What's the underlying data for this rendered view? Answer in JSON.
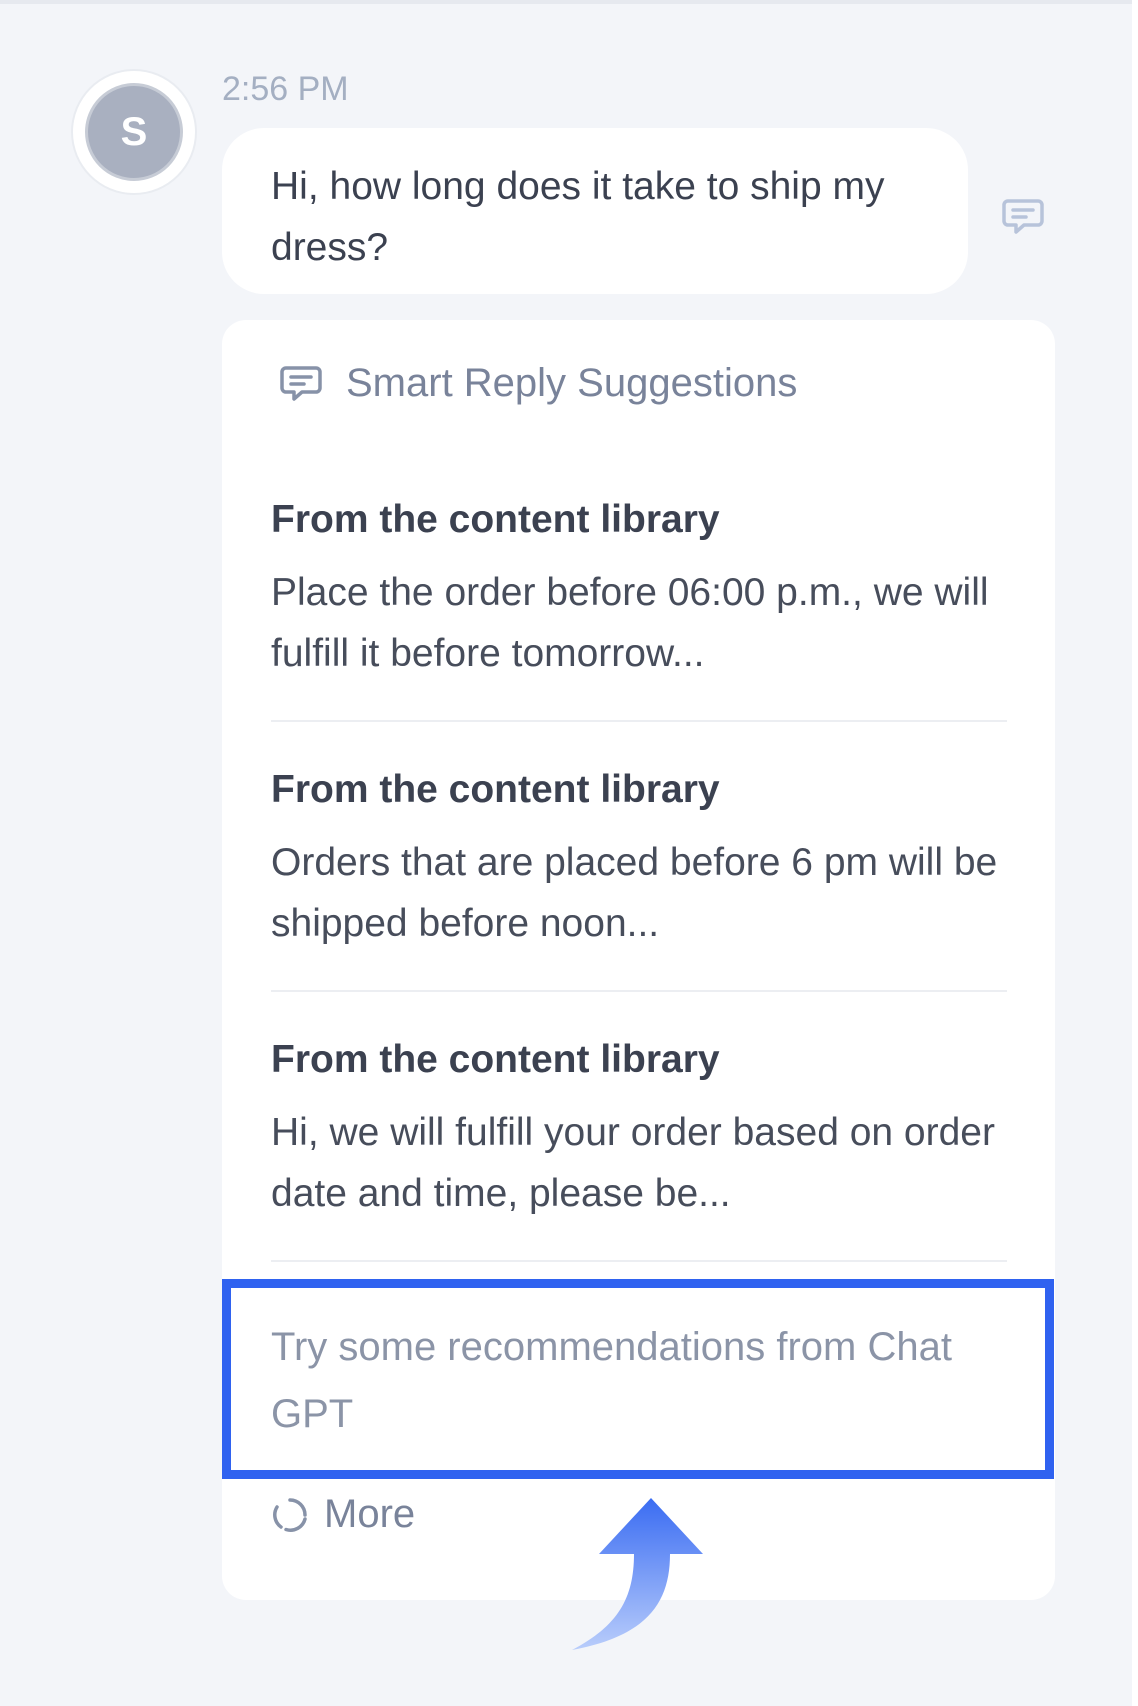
{
  "message": {
    "avatar_initial": "S",
    "timestamp": "2:56 PM",
    "text": "Hi, how long does it take to ship my dress?",
    "reply_icon": "chat-bubble-lines-icon"
  },
  "smart_reply": {
    "title": "Smart Reply Suggestions",
    "icon": "chat-bubble-lines-icon",
    "suggestions": [
      {
        "source": "From the content library",
        "text": "Place the order before 06:00 p.m., we will fulfill it before tomorrow..."
      },
      {
        "source": "From the content library",
        "text": "Orders that are placed before 6 pm will be shipped before noon..."
      },
      {
        "source": "From the content library",
        "text": "Hi, we will fulfill your order based on order date and time, please be..."
      }
    ],
    "gpt_prompt": "Try some recommendations from Chat GPT",
    "more_label": "More",
    "more_icon": "refresh-icon"
  },
  "colors": {
    "highlight": "#2f62f0",
    "arrow_top": "#3a6cf2",
    "arrow_bottom": "#b9cdfb"
  }
}
